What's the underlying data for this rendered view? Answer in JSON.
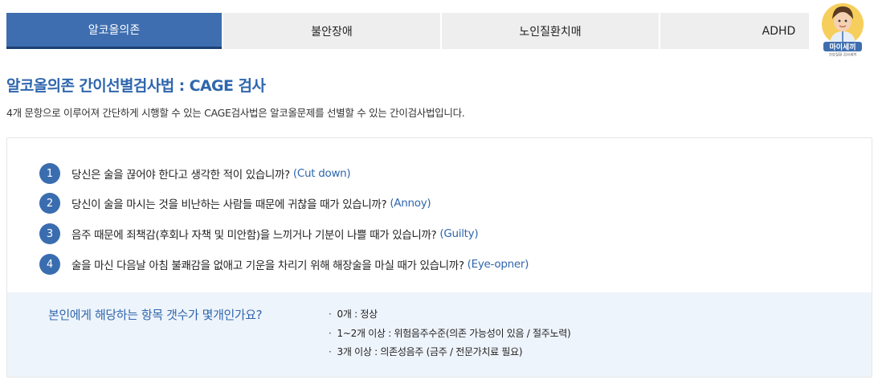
{
  "tabs": [
    {
      "label": "알코올의존",
      "active": true
    },
    {
      "label": "불안장애",
      "active": false
    },
    {
      "label": "노인질환치매",
      "active": false
    },
    {
      "label": "ADHD",
      "active": false
    }
  ],
  "logo": {
    "text": "마이세끼",
    "subtext": "건강질환 검사세끼"
  },
  "page": {
    "title": "알코올의존 간이선별검사법 : CAGE 검사",
    "description": "4개 문항으로 이루어져 간단하게 시행할 수 있는 CAGE검사법은 알코올문제를 선별할 수 있는 간이검사법입니다."
  },
  "questions": [
    {
      "num": "1",
      "text": "당신은 술을 끊어야 한다고 생각한 적이 있습니까?",
      "en": "(Cut down)"
    },
    {
      "num": "2",
      "text": "당신이 술을 마시는 것을 비난하는 사람들 때문에 귀찮을 때가 있습니까?",
      "en": "(Annoy)"
    },
    {
      "num": "3",
      "text": "음주 때문에 죄책감(후회나 자책 및 미안함)을 느끼거나 기분이 나쁠 때가 있습니까?",
      "en": "(Guilty)"
    },
    {
      "num": "4",
      "text": "술을 마신 다음날 아침 불쾌감을 없애고 기운을 차리기 위해 해장술을 마실 때가 있습니까?",
      "en": "(Eye-opner)"
    }
  ],
  "result": {
    "question": "본인에게 해당하는 항목 갯수가 몇개인가요?",
    "items": [
      "0개 : 정상",
      "1~2개 이상 : 위험음주수준(의존 가능성이 있음 / 절주노력)",
      "3개 이상 : 의존성음주 (금주 / 전문가치료 필요)"
    ]
  },
  "colors": {
    "accent": "#3e6eb0",
    "accent_text": "#2f66ad",
    "tab_inactive": "#eeeeee",
    "result_bg": "#eef4fb"
  }
}
